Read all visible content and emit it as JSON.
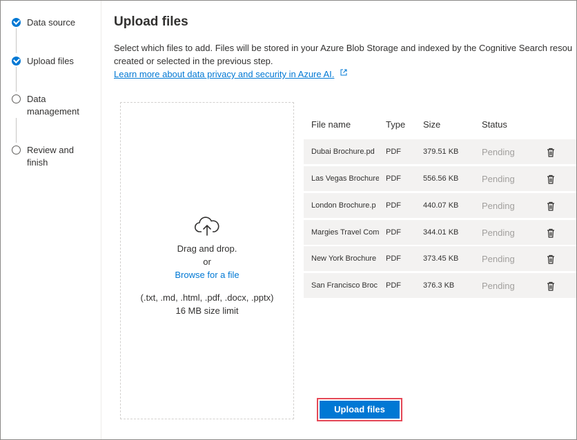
{
  "stepper": {
    "steps": [
      {
        "label": "Data source",
        "state": "completed"
      },
      {
        "label": "Upload files",
        "state": "completed"
      },
      {
        "label": "Data management",
        "state": "pending"
      },
      {
        "label": "Review and finish",
        "state": "pending"
      }
    ]
  },
  "main": {
    "title": "Upload files",
    "description_line1": "Select which files to add. Files will be stored in your Azure Blob Storage and indexed by the Cognitive Search resou",
    "description_line2": "created or selected in the previous step.",
    "learn_more_link": "Learn more about data privacy and security in Azure AI."
  },
  "dropzone": {
    "icon": "cloud-upload-icon",
    "drag_text": "Drag and drop.",
    "or_text": "or",
    "browse_link": "Browse for a file",
    "formats": "(.txt, .md, .html, .pdf, .docx, .pptx)",
    "size_limit": "16 MB size limit"
  },
  "table": {
    "headers": {
      "name": "File name",
      "type": "Type",
      "size": "Size",
      "status": "Status"
    },
    "rows": [
      {
        "name": "Dubai Brochure.pd",
        "type": "PDF",
        "size": "379.51 KB",
        "status": "Pending"
      },
      {
        "name": "Las Vegas Brochure",
        "type": "PDF",
        "size": "556.56 KB",
        "status": "Pending"
      },
      {
        "name": "London Brochure.p",
        "type": "PDF",
        "size": "440.07 KB",
        "status": "Pending"
      },
      {
        "name": "Margies Travel Com",
        "type": "PDF",
        "size": "344.01 KB",
        "status": "Pending"
      },
      {
        "name": "New York Brochure",
        "type": "PDF",
        "size": "373.45 KB",
        "status": "Pending"
      },
      {
        "name": "San Francisco Broc",
        "type": "PDF",
        "size": "376.3 KB",
        "status": "Pending"
      }
    ]
  },
  "actions": {
    "upload_button": "Upload files"
  },
  "colors": {
    "accent": "#0078d4",
    "highlight_outline": "#e74856",
    "row_background": "#f3f2f1",
    "pending_text": "#a19f9d"
  }
}
